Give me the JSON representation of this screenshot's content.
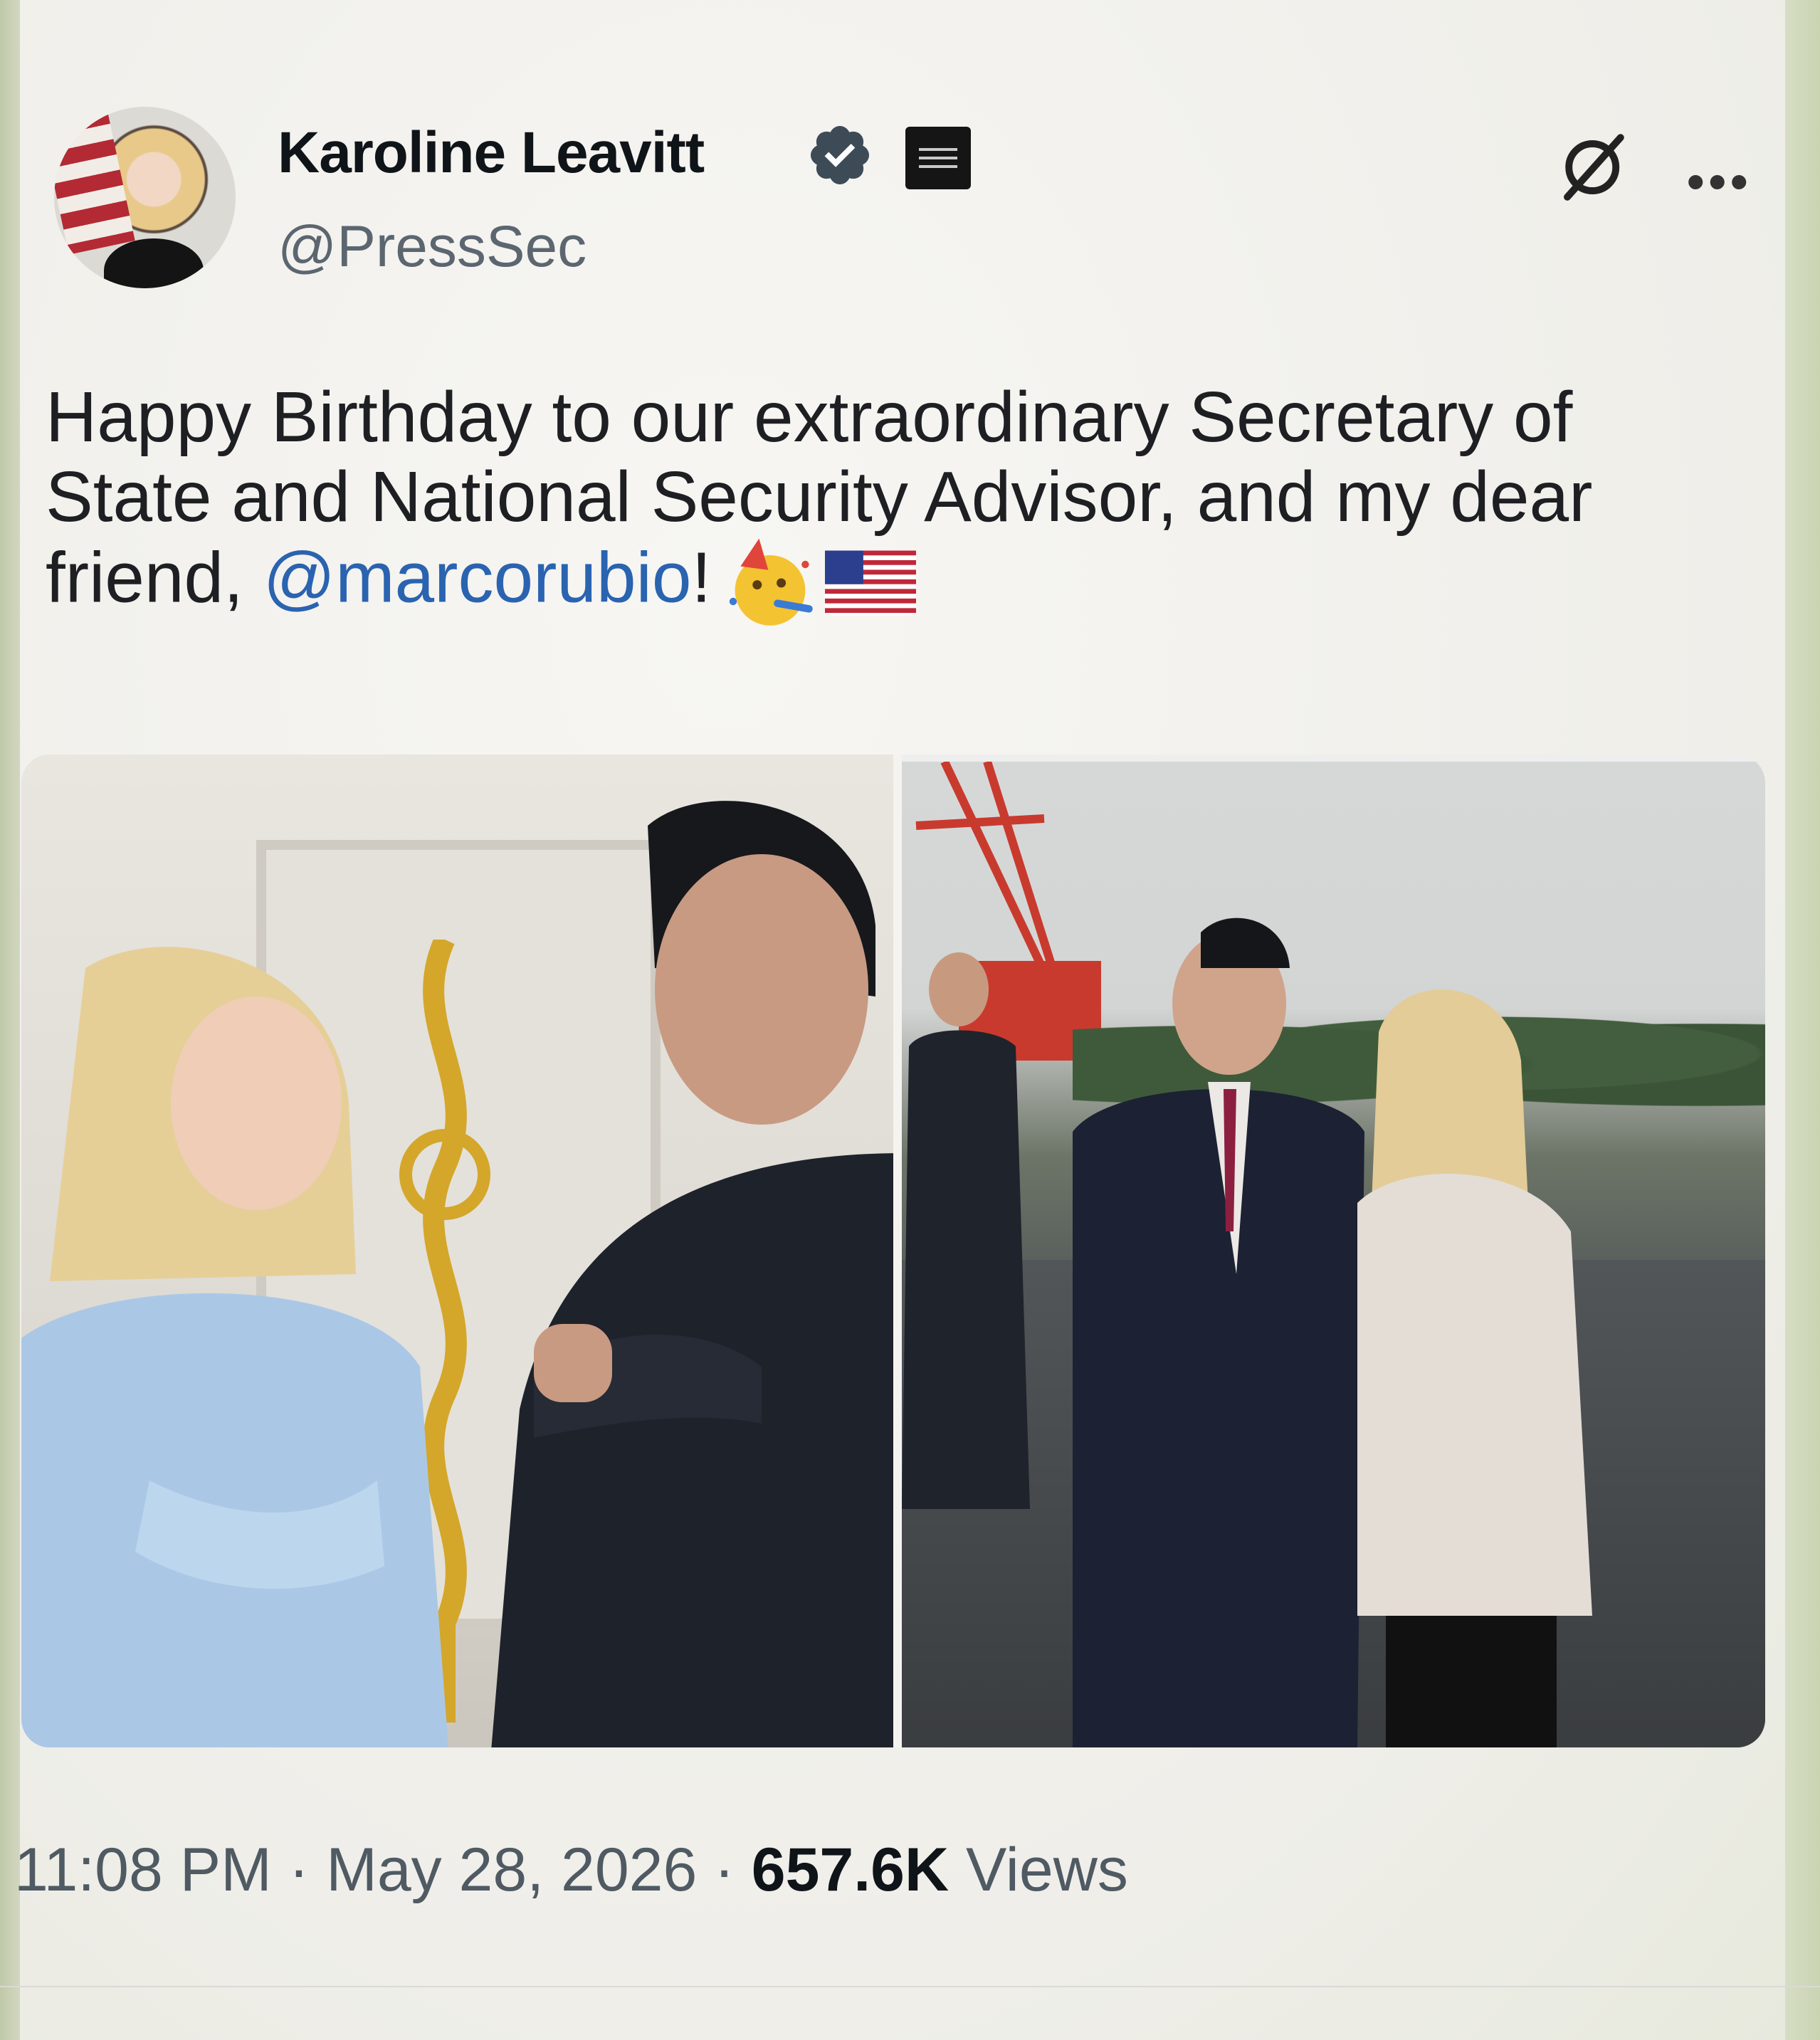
{
  "tweet": {
    "author_name": "Karoline Leavitt",
    "handle": "@PressSec",
    "badge_icon": "verified-badge-icon",
    "affiliation_icon": "white-house-affiliation-icon",
    "text_before": "Happy Birthday to our extraordinary Secretary of State and National Security Advisor, and my dear friend, ",
    "mention": "@marcorubio",
    "text_after": "!",
    "emojis": [
      "partying-face-emoji",
      "us-flag-emoji"
    ],
    "time": "11:08 PM",
    "date": "May 28, 2026",
    "views_count": "657.6K",
    "views_label": "Views",
    "separator": "·"
  },
  "colors": {
    "mention": "#2a63b0",
    "verified": "#3d4b57",
    "text": "#1d1f22"
  }
}
